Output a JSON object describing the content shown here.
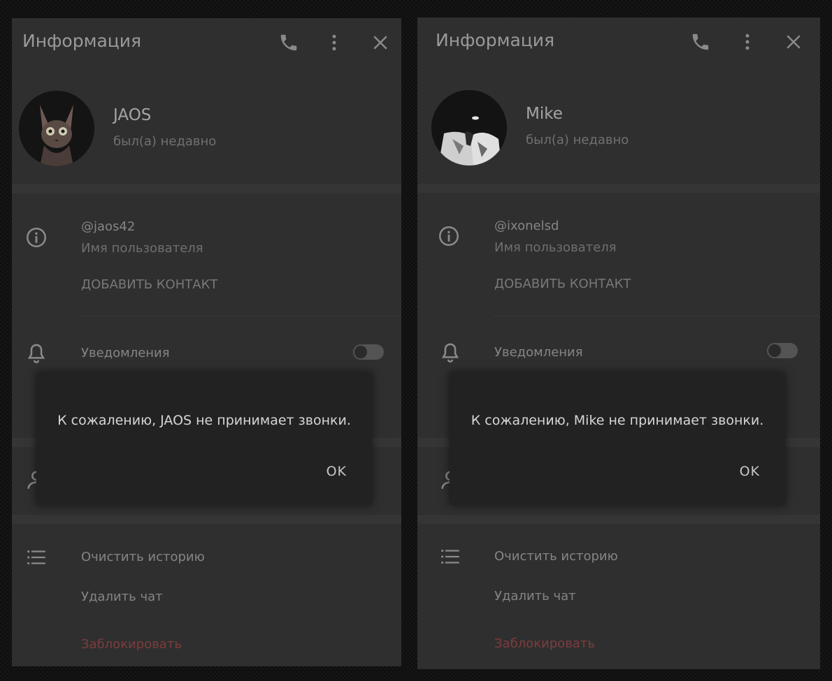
{
  "panels": [
    {
      "title": "Информация",
      "header_icons": [
        "phone-icon",
        "more-vert-icon",
        "close-icon"
      ],
      "contact": {
        "name": "JAOS",
        "status": "был(а) недавно",
        "avatar": "sphynx-cat-photo"
      },
      "info": {
        "username": "@jaos42",
        "username_label": "Имя пользователя",
        "add_contact": "ДОБАВИТЬ КОНТАКТ"
      },
      "notifications": {
        "label": "Уведомления",
        "enabled": false
      },
      "actions": {
        "clear_history": "Очистить историю",
        "delete_chat": "Удалить чат",
        "block": "Заблокировать"
      },
      "dialog": {
        "message": "К сожалению, JAOS не принимает звонки.",
        "ok": "OK"
      }
    },
    {
      "title": "Информация",
      "header_icons": [
        "phone-icon",
        "more-vert-icon",
        "close-icon"
      ],
      "contact": {
        "name": "Mike",
        "status": "был(а) недавно",
        "avatar": "hooded-figure-photo"
      },
      "info": {
        "username": "@ixonelsd",
        "username_label": "Имя пользователя",
        "add_contact": "ДОБАВИТЬ КОНТАКТ"
      },
      "notifications": {
        "label": "Уведомления",
        "enabled": false
      },
      "actions": {
        "clear_history": "Очистить историю",
        "delete_chat": "Удалить чат",
        "block": "Заблокировать"
      },
      "dialog": {
        "message": "К сожалению, Mike не принимает звонки.",
        "ok": "OK"
      }
    }
  ],
  "colors": {
    "panel_bg": "#2f2f2f",
    "dialog_bg": "#222222",
    "danger": "#7e3c3c",
    "text": "#858585"
  }
}
